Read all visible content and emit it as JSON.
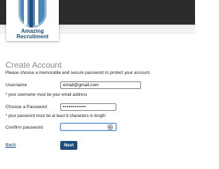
{
  "brand": {
    "line1": "Amazing",
    "line2": "Recruitment"
  },
  "page": {
    "title": "Create Account",
    "intro": "Please choose a memorable and secure password to protect your account."
  },
  "username": {
    "label": "Username",
    "value": "email@gmail.com",
    "hint": "* your username must be your email address"
  },
  "password": {
    "label": "Choose a Password",
    "value": "••••••••••••",
    "hint": "* your password must be at least 6 characters in length"
  },
  "confirm": {
    "label": "Confirm password",
    "value": ""
  },
  "actions": {
    "back": "Back",
    "next": "Next"
  },
  "colors": {
    "brand_blue": "#1d4e7f",
    "link": "#1a4f9c",
    "header": "#2c2c2c"
  }
}
